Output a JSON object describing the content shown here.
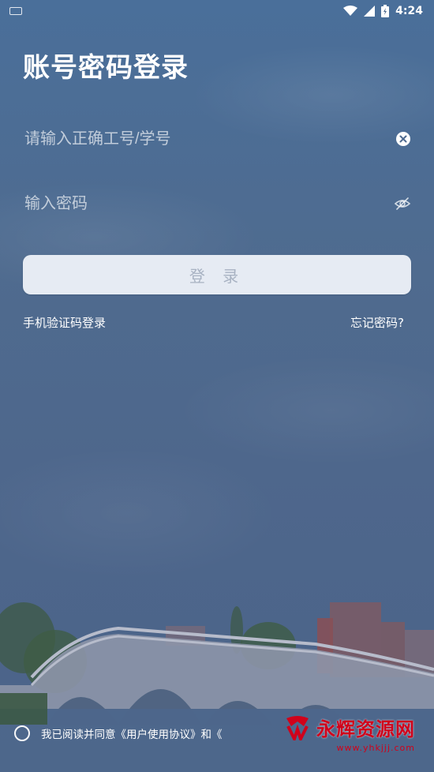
{
  "status_bar": {
    "time": "4:24",
    "icons": [
      "keyboard-icon",
      "wifi-icon",
      "signal-icon",
      "battery-icon"
    ]
  },
  "title": "账号密码登录",
  "username": {
    "placeholder": "请输入正确工号/学号",
    "value": ""
  },
  "password": {
    "placeholder": "输入密码",
    "value": ""
  },
  "login_button": "登 录",
  "sms_login_link": "手机验证码登录",
  "forgot_password_link": "忘记密码?",
  "agreement": {
    "prefix": "我已阅读并同意《用户使用协议》和《",
    "checked": false
  },
  "watermark": {
    "text": "永辉资源网",
    "url": "www.yhkjjj.com"
  },
  "colors": {
    "background": "#4e6a8f",
    "button_bg": "#e6ebf3",
    "button_text": "#a8b2c2",
    "watermark": "#d0021b"
  }
}
